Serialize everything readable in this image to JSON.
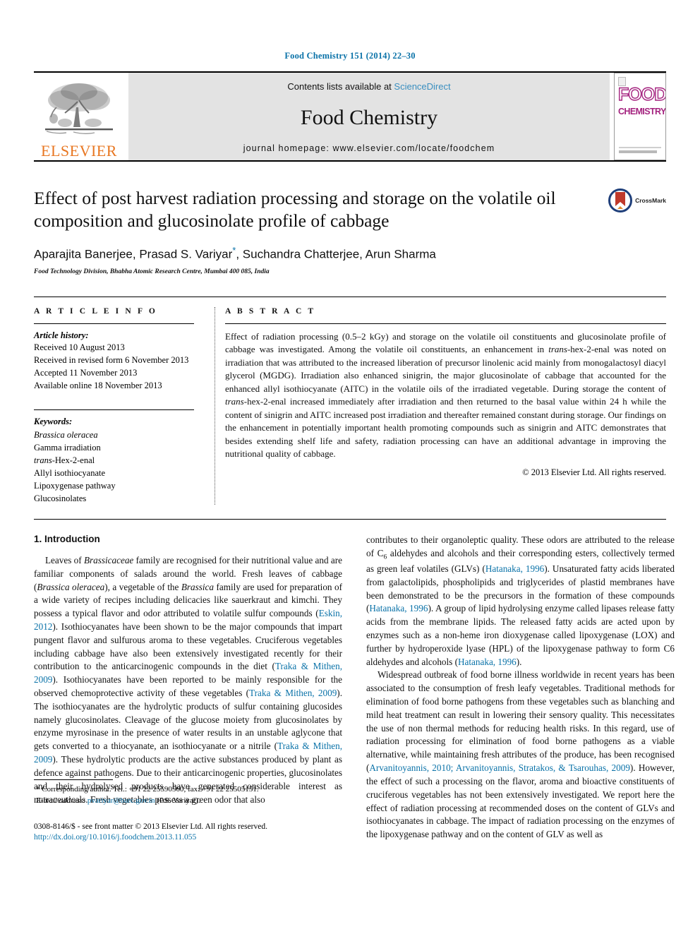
{
  "running_head": "Food Chemistry 151 (2014) 22–30",
  "masthead": {
    "publisher_name": "ELSEVIER",
    "contents_prefix": "Contents lists available at ",
    "sciencedirect": "ScienceDirect",
    "journal_title": "Food Chemistry",
    "homepage": "journal homepage: www.elsevier.com/locate/foodchem",
    "cover": {
      "line1": "FOOD",
      "line2": "CHEMISTRY"
    },
    "link_color": "#3a8fc0"
  },
  "article": {
    "title": "Effect of post harvest radiation processing and storage on the volatile oil composition and glucosinolate profile of cabbage",
    "authors_pre": "Aparajita Banerjee, Prasad S. Variyar",
    "authors_post": ", Suchandra Chatterjee, Arun Sharma",
    "corresponding_marker": "*",
    "affiliation": "Food Technology Division, Bhabha Atomic Research Centre, Mumbai 400 085, India",
    "crossmark_label": "CrossMark"
  },
  "info": {
    "heading": "A R T I C L E   I N F O",
    "history_label": "Article history:",
    "history": [
      "Received 10 August 2013",
      "Received in revised form 6 November 2013",
      "Accepted 11 November 2013",
      "Available online 18 November 2013"
    ],
    "keywords_label": "Keywords:",
    "keywords": [
      "Brassica oleracea",
      "Gamma irradiation",
      "trans-Hex-2-enal",
      "Allyl isothiocyanate",
      "Lipoxygenase pathway",
      "Glucosinolates"
    ]
  },
  "abstract": {
    "heading": "A B S T R A C T",
    "text": "Effect of radiation processing (0.5–2 kGy) and storage on the volatile oil constituents and glucosinolate profile of cabbage was investigated. Among the volatile oil constituents, an enhancement in trans-hex-2-enal was noted on irradiation that was attributed to the increased liberation of precursor linolenic acid mainly from monogalactosyl diacyl glycerol (MGDG). Irradiation also enhanced sinigrin, the major glucosinolate of cabbage that accounted for the enhanced allyl isothiocyanate (AITC) in the volatile oils of the irradiated vegetable. During storage the content of trans-hex-2-enal increased immediately after irradiation and then returned to the basal value within 24 h while the content of sinigrin and AITC increased post irradiation and thereafter remained constant during storage. Our findings on the enhancement in potentially important health promoting compounds such as sinigrin and AITC demonstrates that besides extending shelf life and safety, radiation processing can have an additional advantage in improving the nutritional quality of cabbage.",
    "copyright": "© 2013 Elsevier Ltd. All rights reserved."
  },
  "introduction": {
    "section_title": "1. Introduction",
    "left_paragraph_1": "Leaves of Brassicaceae family are recognised for their nutritional value and are familiar components of salads around the world. Fresh leaves of cabbage (Brassica oleracea), a vegetable of the Brassica family are used for preparation of a wide variety of recipes including delicacies like sauerkraut and kimchi. They possess a typical flavor and odor attributed to volatile sulfur compounds (Eskin, 2012). Isothiocyanates have been shown to be the major compounds that impart pungent flavor and sulfurous aroma to these vegetables. Cruciferous vegetables including cabbage have also been extensively investigated recently for their contribution to the anticarcinogenic compounds in the diet (Traka & Mithen, 2009). Isothiocyanates have been reported to be mainly responsible for the observed chemoprotective activity of these vegetables (Traka & Mithen, 2009). The isothiocyanates are the hydrolytic products of sulfur containing glucosides namely glucosinolates. Cleavage of the glucose moiety from glucosinolates by enzyme myrosinase in the presence of water results in an unstable aglycone that gets converted to a thiocyanate, an isothiocyanate or a nitrile (Traka & Mithen, 2009). These hydrolytic products are the active substances produced by plant as defence against pathogens. Due to their anticarcinogenic properties, glucosinolates and their hydrolysed products have generated considerable interest as nutraceuticals. Fresh vegetables possess a green odor that also",
    "right_paragraph_1": "contributes to their organoleptic quality. These odors are attributed to the release of C6 aldehydes and alcohols and their corresponding esters, collectively termed as green leaf volatiles (GLVs) (Hatanaka, 1996). Unsaturated fatty acids liberated from galactolipids, phospholipids and triglycerides of plastid membranes have been demonstrated to be the precursors in the formation of these compounds (Hatanaka, 1996). A group of lipid hydrolysing enzyme called lipases release fatty acids from the membrane lipids. The released fatty acids are acted upon by enzymes such as a non-heme iron dioxygenase called lipoxygenase (LOX) and further by hydroperoxide lyase (HPL) of the lipoxygenase pathway to form C6 aldehydes and alcohols (Hatanaka, 1996).",
    "right_paragraph_2": "Widespread outbreak of food borne illness worldwide in recent years has been associated to the consumption of fresh leafy vegetables. Traditional methods for elimination of food borne pathogens from these vegetables such as blanching and mild heat treatment can result in lowering their sensory quality. This necessitates the use of non thermal methods for reducing health risks. In this regard, use of radiation processing for elimination of food borne pathogens as a viable alternative, while maintaining fresh attributes of the produce, has been recognised (Arvanitoyannis, 2010; Arvanitoyannis, Stratakos, & Tsarouhas, 2009). However, the effect of such a processing on the flavor, aroma and bioactive constituents of cruciferous vegetables has not been extensively investigated. We report here the effect of radiation processing at recommended doses on the content of GLVs and isothiocyanates in cabbage. The impact of radiation processing on the enzymes of the lipoxygenase pathway and on the content of GLV as well as"
  },
  "footnote": {
    "corresponding": "* Corresponding author. Tel.: +91 22 25590560; fax: +91 22 25505151.",
    "email_label": "E-mail address:",
    "email": "pvariyar@barc.gov.in",
    "email_suffix": " (P.S. Variyar)."
  },
  "footer": {
    "issn_line": "0308-8146/$ - see front matter © 2013 Elsevier Ltd. All rights reserved.",
    "doi": "http://dx.doi.org/10.1016/j.foodchem.2013.11.055"
  }
}
